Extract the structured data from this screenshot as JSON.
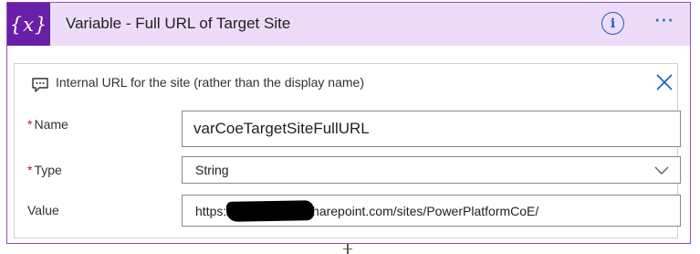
{
  "header": {
    "icon_label": "{x}",
    "title": "Variable - Full URL of Target Site",
    "info_label": "i",
    "more_label": "⋯"
  },
  "description": {
    "text": "Internal URL for the site (rather than the display name)"
  },
  "fields": {
    "name": {
      "label": "Name",
      "required": "*",
      "value": "varCoeTargetSiteFullURL"
    },
    "type": {
      "label": "Type",
      "required": "*",
      "value": "String"
    },
    "value": {
      "label": "Value",
      "prefix": "https://",
      "suffix": "harepoint.com/sites/PowerPlatformCoE/"
    }
  },
  "colors": {
    "accent": "#6a1fa8",
    "header_bg": "#ecdcf7",
    "link_blue": "#1b5fb8",
    "required_red": "#a4262c"
  },
  "icons": [
    "variable-icon",
    "info-icon",
    "more-icon",
    "comment-icon",
    "close-icon",
    "chevron-down-icon"
  ]
}
